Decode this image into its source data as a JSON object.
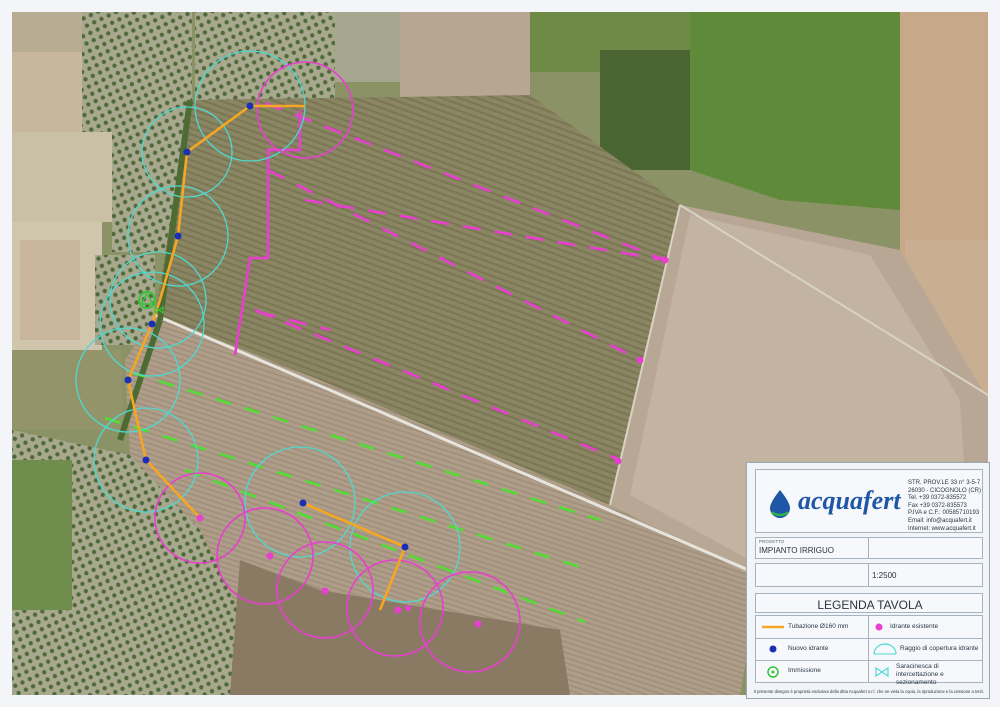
{
  "company": {
    "logo_text": "acquafert",
    "address_lines": [
      "STR. PROV.LE 33 n° 3-5-7",
      "26030 - CICOGNOLO (CR)",
      "Tel. +39 0372-835572",
      "Fax +39 0372-835573",
      "P.IVA e C.F.: 00585710193",
      "Email: info@acquafert.it",
      "Internet: www.acquafert.it"
    ]
  },
  "project": {
    "label": "PROGETTO",
    "title": "IMPIANTO IRRIGUO",
    "scale": "1:2500"
  },
  "legend": {
    "title": "LEGENDA TAVOLA",
    "items": [
      {
        "symbol": "orange-line",
        "label": "Tubazione Ø160 mm"
      },
      {
        "symbol": "magenta-dot",
        "label": "Idrante esistente"
      },
      {
        "symbol": "blue-dot",
        "label": "Nuovo idrante"
      },
      {
        "symbol": "cyan-arc",
        "label": "Raggio di copertura idrante"
      },
      {
        "symbol": "green-circle",
        "label": "Immissione"
      },
      {
        "symbol": "valve",
        "label": "Saracinesca di intercettazione e sezionamento"
      }
    ],
    "footer": "Il presente disegno è proprietà esclusiva della ditta Acquafert s.r.l. che ne vieta la copia, la riproduzione e la cessione a terzi."
  },
  "colors": {
    "pipe": "#f5a623",
    "existing_hydrant": "#e83fd0",
    "new_hydrant": "#1a2fb8",
    "coverage_arc": "#4fd8d0",
    "inlet": "#36c43a",
    "green_lines": "#52dd33",
    "brand": "#1f56a6"
  }
}
